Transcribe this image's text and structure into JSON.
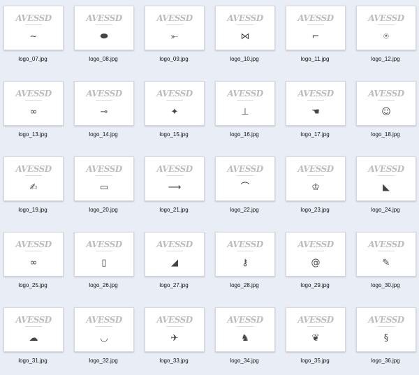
{
  "brand": "AVESSD",
  "files": [
    {
      "name": "logo_07.jpg",
      "icon": "hand-stamp-icon",
      "glyph": "~"
    },
    {
      "name": "logo_08.jpg",
      "icon": "fish-icon",
      "glyph": "⬬"
    },
    {
      "name": "logo_09.jpg",
      "icon": "bird-icon",
      "glyph": "⤜"
    },
    {
      "name": "logo_10.jpg",
      "icon": "bow-tie-icon",
      "glyph": "⋈"
    },
    {
      "name": "logo_11.jpg",
      "icon": "gun-icon",
      "glyph": "⌐"
    },
    {
      "name": "logo_12.jpg",
      "icon": "crest-icon",
      "glyph": "⍟"
    },
    {
      "name": "logo_13.jpg",
      "icon": "glasses-icon",
      "glyph": "∞"
    },
    {
      "name": "logo_14.jpg",
      "icon": "trumpet-icon",
      "glyph": "⊸"
    },
    {
      "name": "logo_15.jpg",
      "icon": "beetle-icon",
      "glyph": "✦"
    },
    {
      "name": "logo_16.jpg",
      "icon": "stamp-icon",
      "glyph": "⊥"
    },
    {
      "name": "logo_17.jpg",
      "icon": "hand-icon",
      "glyph": "☚"
    },
    {
      "name": "logo_18.jpg",
      "icon": "portrait-icon",
      "glyph": "☺"
    },
    {
      "name": "logo_19.jpg",
      "icon": "signature-icon",
      "glyph": "✍"
    },
    {
      "name": "logo_20.jpg",
      "icon": "box-icon",
      "glyph": "▭"
    },
    {
      "name": "logo_21.jpg",
      "icon": "arrow-icon",
      "glyph": "⟶"
    },
    {
      "name": "logo_22.jpg",
      "icon": "mustache-icon",
      "glyph": "⌒"
    },
    {
      "name": "logo_23.jpg",
      "icon": "crown-icon",
      "glyph": "♔"
    },
    {
      "name": "logo_24.jpg",
      "icon": "cat-icon",
      "glyph": "◣"
    },
    {
      "name": "logo_25.jpg",
      "icon": "knot-icon",
      "glyph": "∞"
    },
    {
      "name": "logo_26.jpg",
      "icon": "lantern-icon",
      "glyph": "▯"
    },
    {
      "name": "logo_27.jpg",
      "icon": "shoe-icon",
      "glyph": "◢"
    },
    {
      "name": "logo_28.jpg",
      "icon": "key-icon",
      "glyph": "⚷"
    },
    {
      "name": "logo_29.jpg",
      "icon": "snail-icon",
      "glyph": "@"
    },
    {
      "name": "logo_30.jpg",
      "icon": "feather-icon",
      "glyph": "✎"
    },
    {
      "name": "logo_31.jpg",
      "icon": "sheep-icon",
      "glyph": "☁"
    },
    {
      "name": "logo_32.jpg",
      "icon": "mouth-icon",
      "glyph": "◡"
    },
    {
      "name": "logo_33.jpg",
      "icon": "swallow-icon",
      "glyph": "✈"
    },
    {
      "name": "logo_34.jpg",
      "icon": "horse-icon",
      "glyph": "♞"
    },
    {
      "name": "logo_35.jpg",
      "icon": "shrimp-icon",
      "glyph": "❦"
    },
    {
      "name": "logo_36.jpg",
      "icon": "lizard-icon",
      "glyph": "§"
    }
  ]
}
